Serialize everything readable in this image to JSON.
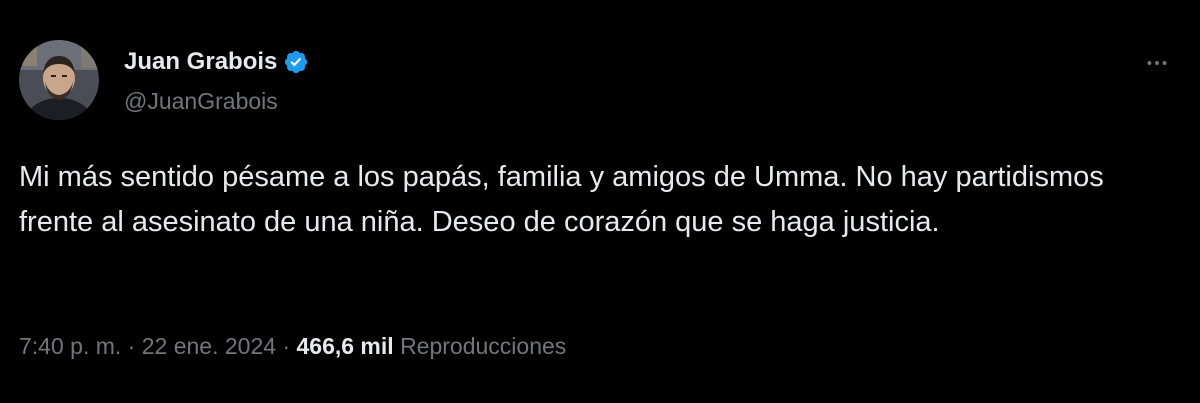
{
  "author": {
    "display_name": "Juan Grabois",
    "handle": "@JuanGrabois",
    "verified": true,
    "avatar_icon": "user-avatar"
  },
  "more_icon": "more-options-icon",
  "tweet": {
    "text": "Mi más sentido pésame a los papás, familia y amigos de Umma. No hay partidismos frente al asesinato de una niña. Deseo de corazón que se haga justicia."
  },
  "meta": {
    "time": "7:40 p. m.",
    "separator_1": "·",
    "date": "22 ene. 2024",
    "separator_2": "·",
    "views_count": "466,6 mil",
    "views_label": "Reproducciones"
  },
  "colors": {
    "background": "#000000",
    "primary_text": "#e7e9ea",
    "secondary_text": "#71767b",
    "verified_badge": "#1d9bf0"
  }
}
